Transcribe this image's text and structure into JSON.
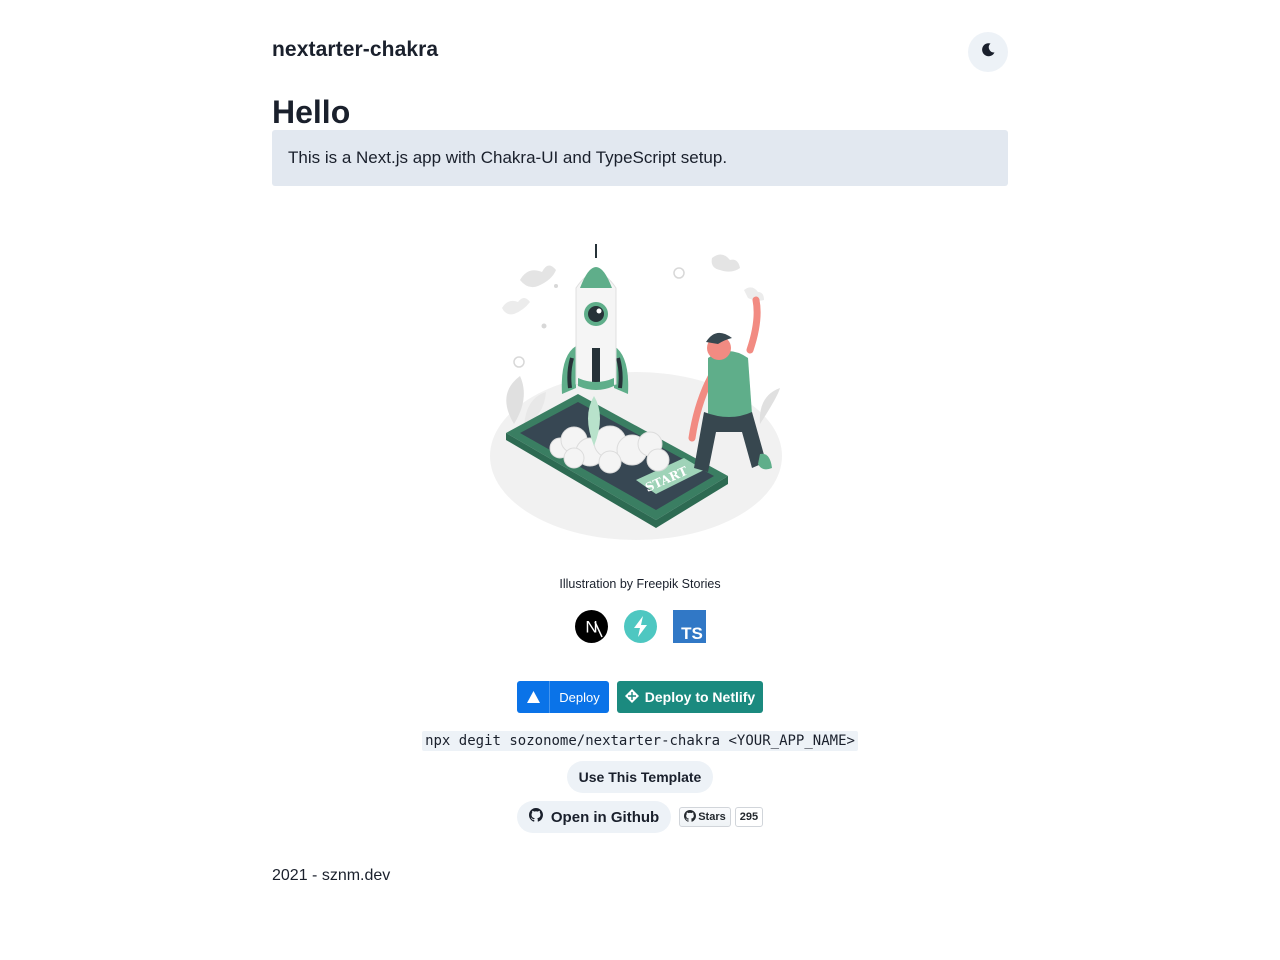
{
  "header": {
    "app_title": "nextarter-chakra",
    "theme_toggle_icon": "moon-icon"
  },
  "main": {
    "heading": "Hello",
    "intro": "This is a Next.js app with Chakra-UI and TypeScript setup.",
    "illustration_credit": "Illustration by Freepik Stories",
    "illustration_start_text": "START",
    "tech_icons": [
      "nextjs-icon",
      "chakra-ui-icon",
      "typescript-icon"
    ],
    "typescript_label": "TS",
    "nextjs_letter": "N"
  },
  "deploy": {
    "vercel_label": "Deploy",
    "netlify_label": "Deploy to Netlify"
  },
  "command": "npx degit sozonome/nextarter-chakra <YOUR_APP_NAME>",
  "template_button": "Use This Template",
  "github": {
    "open_label": "Open in Github",
    "stars_label": "Stars",
    "stars_count": "295"
  },
  "footer": {
    "text": "2021 - sznm.dev"
  },
  "colors": {
    "vercel_blue": "#0a73e8",
    "netlify_teal": "#1b8a7f",
    "intro_bg": "#e2e8f0",
    "button_bg": "#edf2f7",
    "illustration_green": "#5fae8a"
  }
}
